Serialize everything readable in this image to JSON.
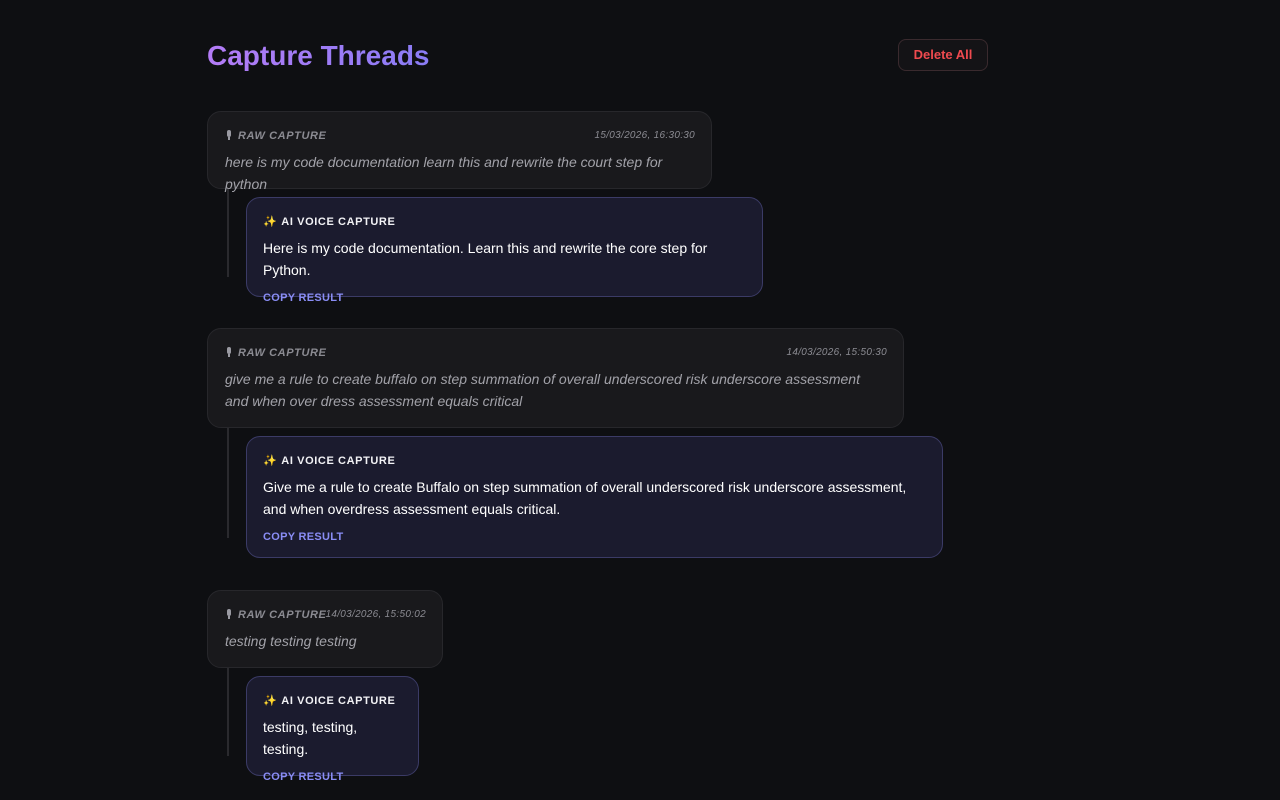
{
  "header": {
    "title": "Capture Threads",
    "delete_all_label": "Delete All"
  },
  "labels": {
    "raw_capture": "RAW CAPTURE",
    "ai_voice_capture": "AI VOICE CAPTURE",
    "copy_result": "COPY RESULT",
    "mic_icon": "microphone-icon",
    "sparkle_icon": "sparkles-icon",
    "sparkle_glyph": "✨"
  },
  "threads": [
    {
      "raw_time": "15/03/2026, 16:30:30",
      "raw_text": "here is my code documentation learn this and rewrite the court step for python",
      "ai_text": "Here is my code documentation. Learn this and rewrite the core step for Python."
    },
    {
      "raw_time": "14/03/2026, 15:50:30",
      "raw_text": "give me a rule to create buffalo on step summation of overall underscored risk underscore assessment and when over dress assessment equals critical",
      "ai_text": "Give me a rule to create Buffalo on step summation of overall underscored risk underscore assessment, and when overdress assessment equals critical."
    },
    {
      "raw_time": "14/03/2026, 15:50:02",
      "raw_text": "testing testing testing",
      "ai_text": "testing, testing, testing."
    }
  ],
  "colors": {
    "accent_gradient_start": "#b47cf7",
    "accent_gradient_end": "#8a7cf5",
    "danger": "#ef4a4f",
    "copy_link": "#8a8df5"
  }
}
